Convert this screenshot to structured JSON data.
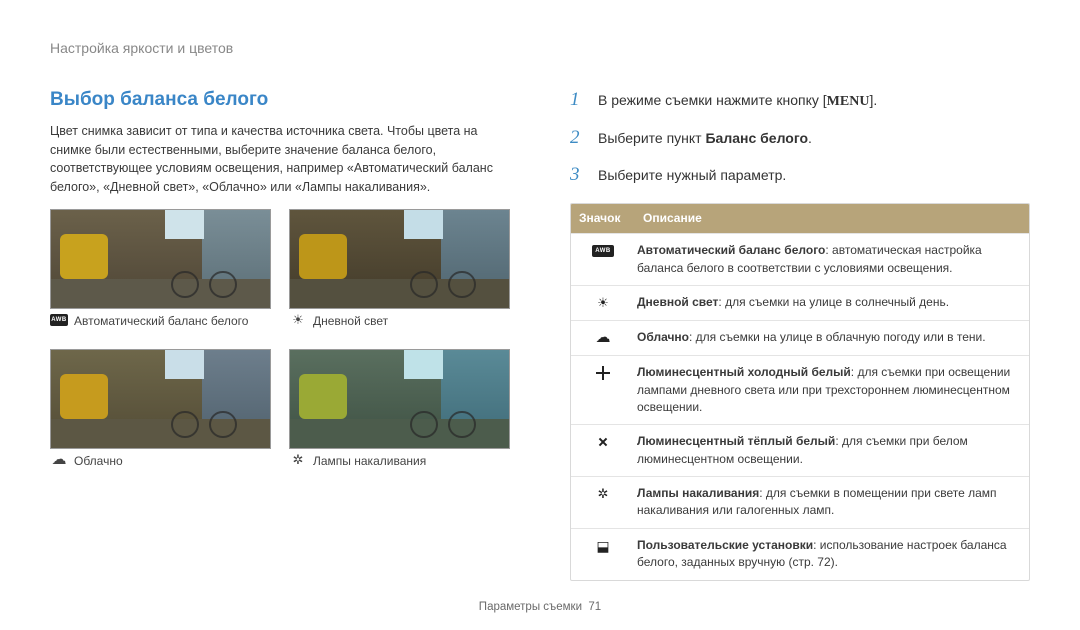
{
  "chapter": "Настройка яркости и цветов",
  "title": "Выбор баланса белого",
  "intro": "Цвет снимка зависит от типа и качества источника света. Чтобы цвета на снимке были естественными, выберите значение баланса белого, соответствующее условиям освещения, например «Автоматический баланс белого», «Дневной свет», «Облачно» или «Лампы накаливания».",
  "thumbs": {
    "awb": "Автоматический баланс белого",
    "day": "Дневной свет",
    "cld": "Облачно",
    "tun": "Лампы накаливания",
    "awb_badge": "AWB"
  },
  "steps": {
    "s1_a": "В режиме съемки нажмите кнопку [",
    "s1_menu": "MENU",
    "s1_b": "].",
    "s2_a": "Выберите пункт ",
    "s2_b": "Баланс белого",
    "s2_c": ".",
    "s3": "Выберите нужный параметр.",
    "n1": "1",
    "n2": "2",
    "n3": "3"
  },
  "table": {
    "h_icon": "Значок",
    "h_desc": "Описание",
    "rows": [
      {
        "bold": "Автоматический баланс белого",
        "rest": ": автоматическая настройка баланса белого в соответствии с условиями освещения."
      },
      {
        "bold": "Дневной свет",
        "rest": ": для съемки на улице в солнечный день."
      },
      {
        "bold": "Облачно",
        "rest": ": для съемки на улице в облачную погоду или в тени."
      },
      {
        "bold": "Люминесцентный холодный белый",
        "rest": ": для съемки при освещении лампами дневного света или при трехстороннем люминесцентном освещении."
      },
      {
        "bold": "Люминесцентный тёплый белый",
        "rest": ": для съемки при белом люминесцентном освещении."
      },
      {
        "bold": "Лампы накаливания",
        "rest": ": для съемки в помещении при свете ламп накаливания или галогенных ламп."
      },
      {
        "bold": "Пользовательские установки",
        "rest": ": использование настроек баланса белого, заданных вручную (стр. 72)."
      }
    ]
  },
  "footer_label": "Параметры съемки",
  "footer_page": "71"
}
